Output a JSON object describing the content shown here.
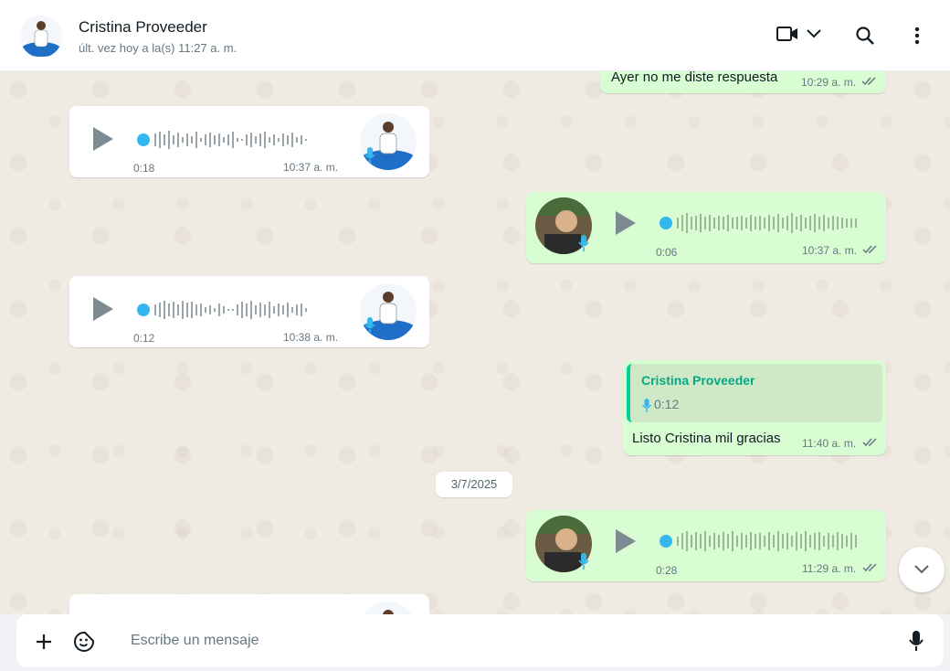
{
  "header": {
    "contact_name": "Cristina Proveeder",
    "contact_status": "últ. vez hoy a la(s) 11:27 a. m."
  },
  "messages": [
    {
      "direction": "out",
      "type": "text",
      "text": "Ayer no me diste respuesta",
      "time": "10:29 a. m."
    },
    {
      "direction": "in",
      "type": "voice",
      "duration": "0:18",
      "time": "10:37 a. m."
    },
    {
      "direction": "out",
      "type": "voice",
      "duration": "0:06",
      "time": "10:37 a. m."
    },
    {
      "direction": "in",
      "type": "voice",
      "duration": "0:12",
      "time": "10:38 a. m."
    },
    {
      "direction": "out",
      "type": "reply",
      "quote_name": "Cristina Proveeder",
      "quote_duration": "0:12",
      "text": "Listo Cristina mil gracias",
      "time": "11:40 a. m."
    },
    {
      "direction": "out",
      "type": "voice",
      "duration": "0:28",
      "time": "11:29 a. m."
    }
  ],
  "date_separator": "3/7/2025",
  "composer": {
    "placeholder": "Escribe un mensaje"
  },
  "colors": {
    "incoming_bubble": "#ffffff",
    "outgoing_bubble": "#d9fdd3",
    "chat_background": "#efeae2",
    "accent_blue": "#34b7f1",
    "accent_green": "#06cf9c"
  },
  "icons": [
    "video-call-icon",
    "chevron-down-icon",
    "search-icon",
    "menu-icon",
    "play-icon",
    "mic-icon",
    "double-check-icon",
    "plus-icon",
    "sticker-icon",
    "scroll-down-icon"
  ]
}
